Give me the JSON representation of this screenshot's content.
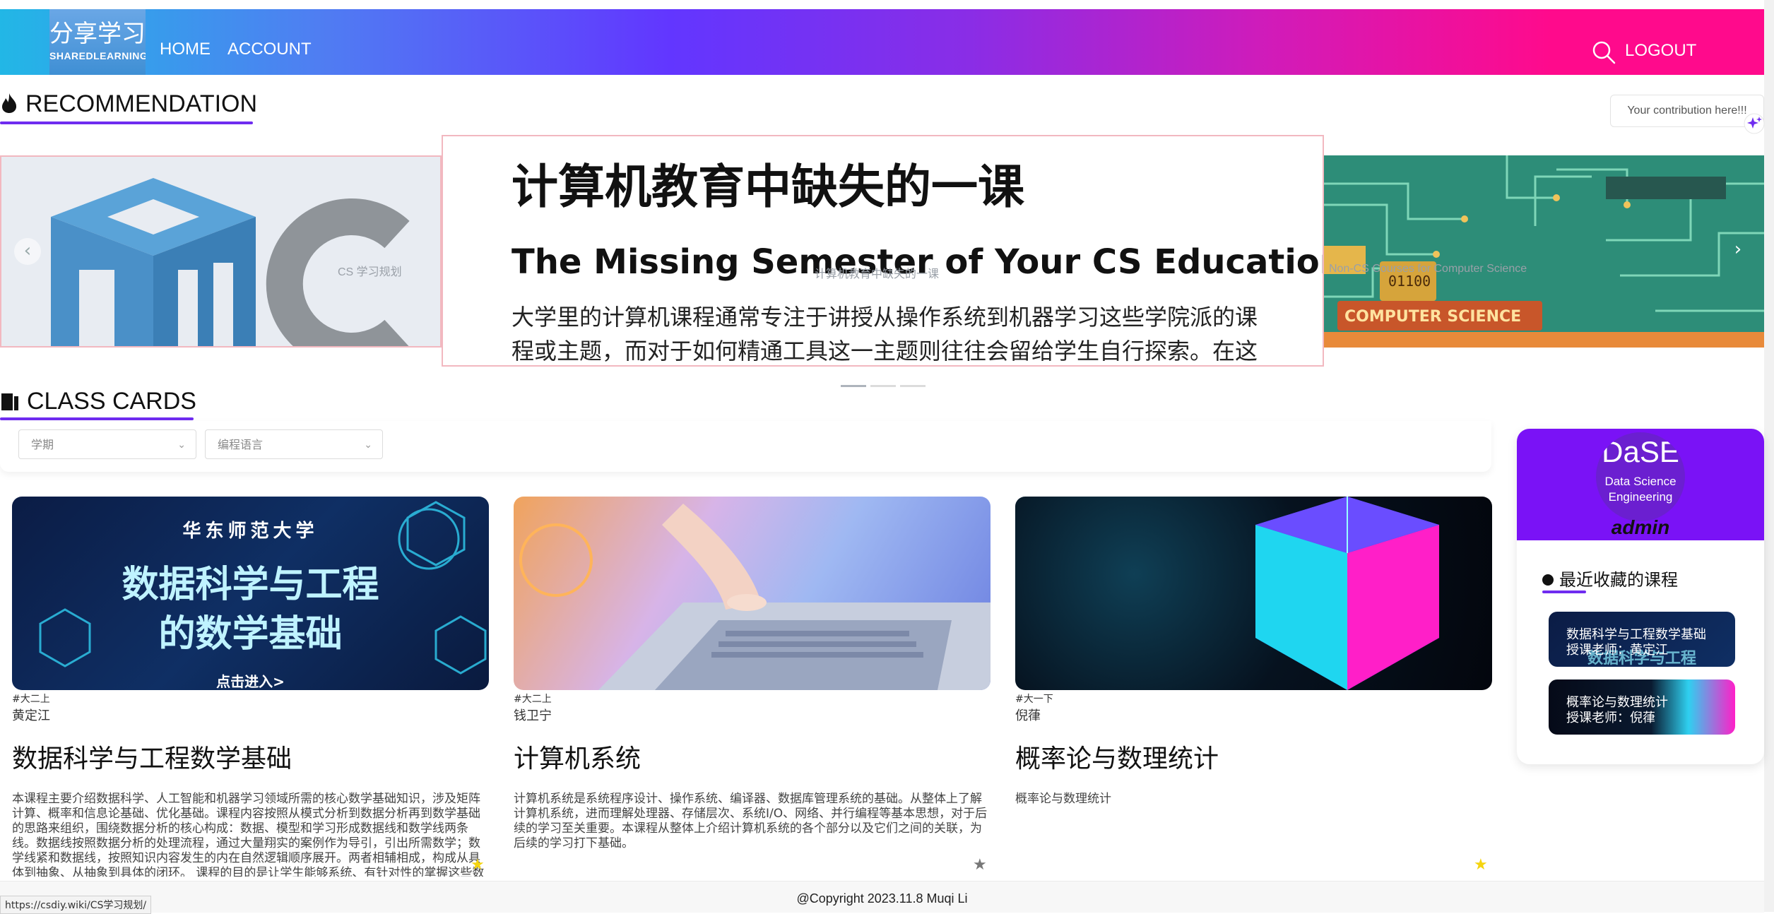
{
  "nav": {
    "logo_zh": "分享学习",
    "logo_en": "SHAREDLEARNING",
    "home": "HOME",
    "account": "ACCOUNT",
    "logout": "LOGOUT"
  },
  "recommendation": {
    "title": "RECOMMENDATION",
    "contribution": "Your contribution here!!!",
    "slides": {
      "left_caption": "CS 学习规划",
      "center_caption": "计算机教育中缺失的一课",
      "center_title": "计算机教育中缺失的一课",
      "center_subtitle": "The Missing Semester of Your CS Education 中文版",
      "center_body": "大学里的计算机课程通常专注于讲授从操作系统到机器学习这些学院派的课程或主题，而对于如何精通工具这一主题则往往会留给学生自行探索。在这",
      "right_caption": "Non-CS Courses for Computer Science"
    }
  },
  "class_cards": {
    "title": "CLASS CARDS",
    "filters": {
      "term_placeholder": "学期",
      "language_placeholder": "编程语言"
    },
    "cards": [
      {
        "term": "#大二上",
        "teacher": "黄定江",
        "name": "数据科学与工程数学基础",
        "image_title_top": "华东师范大学",
        "image_title_line1": "数据科学与工程",
        "image_title_line2": "的数学基础",
        "image_cta": "点击进入>",
        "description": "本课程主要介绍数据科学、人工智能和机器学习领域所需的核心数学基础知识，涉及矩阵计算、概率和信息论基础、优化基础。课程内容按照从模式分析到数据分析再到数学基础的思路来组织，围绕数据分析的核心构成：数据、模型和学习形成数据线和数学线两条线。数据线按照数据分析的处理流程，通过大量翔实的案例作为导引，引出所需数学；数学线紧和数据线，按照知识内容发生的内在自然逻辑顺序展开。两者相辅相成，构成从具体到抽象、从抽象到具体的闭环。 课程的目的是让学生能够系统、有针对性的掌握这些数学基础知识，能够使用他们去理解和分析各类数据处理算法涉及的数学",
        "favorited": true
      },
      {
        "term": "#大二上",
        "teacher": "钱卫宁",
        "name": "计算机系统",
        "description": "计算机系统是系统程序设计、操作系统、编译器、数据库管理系统的基础。从整体上了解计算机系统，进而理解处理器、存储层次、系统I/O、网络、并行编程等基本思想，对于后续的学习至关重要。本课程从整体上介绍计算机系统的各个部分以及它们之间的关联，为后续的学习打下基础。",
        "favorited": false
      },
      {
        "term": "#大一下",
        "teacher": "倪葎",
        "name": "概率论与数理统计",
        "description": "概率论与数理统计",
        "favorited": true
      }
    ]
  },
  "side_panel": {
    "avatar_line1": "DaSE",
    "avatar_line2": "Data Science",
    "avatar_line3": "Engineering",
    "username": "admin",
    "favorites_title": "最近收藏的课程",
    "favorites": [
      {
        "course": "数据科学与工程数学基础",
        "teacher": "授课老师：黄定江",
        "bg_text": "数据科学与工程"
      },
      {
        "course": "概率论与数理统计",
        "teacher": "授课老师：倪葎"
      }
    ]
  },
  "footer": {
    "copyright": "@Copyright 2023.11.8 Muqi Li",
    "status_url": "https://csdiy.wiki/CS学习规划/"
  },
  "colors": {
    "accent": "#6f2cf0",
    "nav_gradient_start": "#22b7e6",
    "nav_gradient_end": "#ff0a8c",
    "star_active": "#f5d40f",
    "star_inactive": "#777777"
  }
}
